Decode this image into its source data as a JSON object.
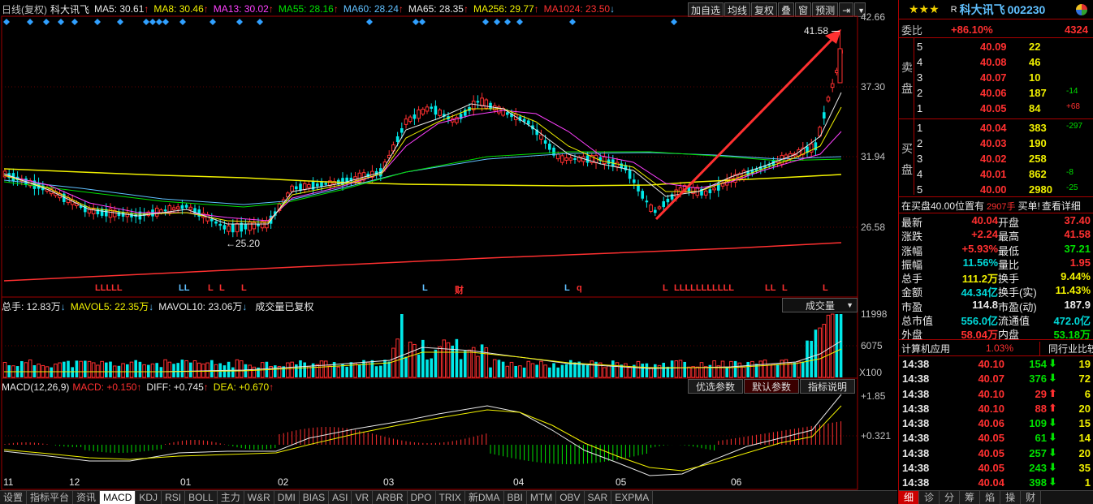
{
  "header": {
    "period": "日线(复权)",
    "stock_name": "科大讯飞",
    "ma": [
      {
        "label": "MA5: 30.61",
        "color": "#e8e8e8"
      },
      {
        "label": "MA8: 30.46",
        "color": "#f0f000"
      },
      {
        "label": "MA13: 30.02",
        "color": "#ff40ff"
      },
      {
        "label": "MA55: 28.16",
        "color": "#00e000"
      },
      {
        "label": "MA60: 28.24",
        "color": "#60c0ff"
      },
      {
        "label": "MA65: 28.35",
        "color": "#e8e8e8"
      },
      {
        "label": "MA256: 29.77",
        "color": "#f0f000"
      },
      {
        "label": "MA1024: 23.50",
        "color": "#ff3030"
      }
    ],
    "buttons": [
      "加自选",
      "均线",
      "复权",
      "叠",
      "窗",
      "预测"
    ]
  },
  "price_axis": [
    "42.66",
    "37.30",
    "31.94",
    "26.58"
  ],
  "annotations": {
    "high": "41.58",
    "low": "25.20"
  },
  "signals": [
    {
      "t": "LLLLL",
      "c": "#ff3030"
    },
    {
      "t": "LL",
      "c": "#60c0ff"
    },
    {
      "t": "L",
      "c": "#ff3030"
    },
    {
      "t": "L",
      "c": "#ff3030"
    },
    {
      "t": "L",
      "c": "#ff3030"
    },
    {
      "t": "L",
      "c": "#60c0ff"
    },
    {
      "t": "财",
      "c": "#ff3030"
    },
    {
      "t": "L",
      "c": "#60c0ff"
    },
    {
      "t": "q",
      "c": "#ff3030"
    },
    {
      "t": "L",
      "c": "#ff3030"
    },
    {
      "t": "LLLLLLLLLLL",
      "c": "#ff3030"
    },
    {
      "t": "LL",
      "c": "#ff3030"
    },
    {
      "t": "L",
      "c": "#ff3030"
    },
    {
      "t": "L",
      "c": "#ff3030"
    }
  ],
  "volume": {
    "total": "总手: 12.83万",
    "mavol5": "MAVOL5: 22.35万",
    "mavol10": "MAVOL10: 23.06万",
    "note": "成交量已复权",
    "selector": "成交量",
    "axis": [
      "11998",
      "6075",
      "X100"
    ]
  },
  "macd": {
    "params": "MACD(12,26,9)",
    "macd": "MACD: +0.150",
    "diff": "DIFF: +0.745",
    "dea": "DEA: +0.670",
    "buttons": [
      "优选参数",
      "默认参数",
      "指标说明"
    ],
    "axis": [
      "+1.85",
      "+0.321"
    ]
  },
  "months": [
    "11",
    "12",
    "01",
    "02",
    "03",
    "04",
    "05",
    "06"
  ],
  "tabs": [
    "设置",
    "指标平台",
    "资讯",
    "MACD",
    "KDJ",
    "RSI",
    "BOLL",
    "主力",
    "W&R",
    "DMI",
    "BIAS",
    "ASI",
    "VR",
    "ARBR",
    "DPO",
    "TRIX",
    "新DMA",
    "BBI",
    "MTM",
    "OBV",
    "SAR",
    "EXPMA"
  ],
  "quote": {
    "rating": "★★★",
    "r": "R",
    "name": "科大讯飞",
    "code": "002230",
    "weibi_label": "委比",
    "weibi": "+86.10%",
    "weibi_vol": "4324",
    "sell_label": [
      "卖",
      "盘"
    ],
    "buy_label": [
      "买",
      "盘"
    ],
    "sell": [
      {
        "n": "5",
        "p": "40.09",
        "v": "22",
        "d": ""
      },
      {
        "n": "4",
        "p": "40.08",
        "v": "46",
        "d": ""
      },
      {
        "n": "3",
        "p": "40.07",
        "v": "10",
        "d": ""
      },
      {
        "n": "2",
        "p": "40.06",
        "v": "187",
        "d": "-14"
      },
      {
        "n": "1",
        "p": "40.05",
        "v": "84",
        "d": "+68"
      }
    ],
    "buy": [
      {
        "n": "1",
        "p": "40.04",
        "v": "383",
        "d": "-297"
      },
      {
        "n": "2",
        "p": "40.03",
        "v": "190",
        "d": ""
      },
      {
        "n": "3",
        "p": "40.02",
        "v": "258",
        "d": ""
      },
      {
        "n": "4",
        "p": "40.01",
        "v": "862",
        "d": "-8"
      },
      {
        "n": "5",
        "p": "40.00",
        "v": "2980",
        "d": "-25"
      }
    ],
    "notice": "在买盘40.00位置有",
    "notice_vol": "2907手",
    "notice_tail": "买单!",
    "notice_link": "查看详细",
    "stats": [
      {
        "l": "最新",
        "v": "40.04",
        "vc": "red",
        "l2": "开盘",
        "v2": "37.40",
        "v2c": "red"
      },
      {
        "l": "涨跌",
        "v": "+2.24",
        "vc": "red",
        "l2": "最高",
        "v2": "41.58",
        "v2c": "red"
      },
      {
        "l": "涨幅",
        "v": "+5.93%",
        "vc": "red",
        "l2": "最低",
        "v2": "37.21",
        "v2c": "green"
      },
      {
        "l": "振幅",
        "v": "11.56%",
        "vc": "cyan",
        "l2": "量比",
        "v2": "1.95",
        "v2c": "red"
      },
      {
        "l": "总手",
        "v": "111.2万",
        "vc": "yellow",
        "l2": "换手",
        "v2": "9.44%",
        "v2c": "yellow"
      },
      {
        "l": "金额",
        "v": "44.34亿",
        "vc": "cyan",
        "l2": "换手(实)",
        "v2": "11.43%",
        "v2c": "yellow"
      },
      {
        "l": "市盈",
        "v": "114.8",
        "vc": "white",
        "l2": "市盈(动)",
        "v2": "187.9",
        "v2c": "white"
      },
      {
        "l": "总市值",
        "v": "556.0亿",
        "vc": "cyan",
        "l2": "流通值",
        "v2": "472.0亿",
        "v2c": "cyan"
      },
      {
        "l": "外盘",
        "v": "58.04万",
        "vc": "red",
        "l2": "内盘",
        "v2": "53.18万",
        "v2c": "green"
      }
    ],
    "industry": "计算机应用",
    "industry_pct": "1.03%",
    "industry_btn": "同行业比较",
    "ticks": [
      {
        "t": "14:38",
        "p": "40.10",
        "v": "154",
        "dir": "down",
        "n": "19"
      },
      {
        "t": "14:38",
        "p": "40.07",
        "v": "376",
        "dir": "down",
        "n": "72"
      },
      {
        "t": "14:38",
        "p": "40.10",
        "v": "29",
        "dir": "up",
        "n": "6"
      },
      {
        "t": "14:38",
        "p": "40.10",
        "v": "88",
        "dir": "up",
        "n": "20"
      },
      {
        "t": "14:38",
        "p": "40.06",
        "v": "109",
        "dir": "down",
        "n": "15"
      },
      {
        "t": "14:38",
        "p": "40.05",
        "v": "61",
        "dir": "down",
        "n": "14"
      },
      {
        "t": "14:38",
        "p": "40.05",
        "v": "257",
        "dir": "down",
        "n": "20"
      },
      {
        "t": "14:38",
        "p": "40.05",
        "v": "243",
        "dir": "down",
        "n": "35"
      },
      {
        "t": "14:38",
        "p": "40.04",
        "v": "398",
        "dir": "down",
        "n": "1"
      }
    ],
    "bottom_tabs": [
      "细",
      "诊",
      "分",
      "筹",
      "焰",
      "操",
      "财"
    ]
  }
}
